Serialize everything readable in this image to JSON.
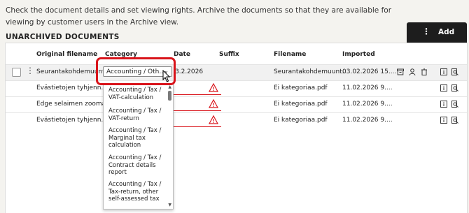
{
  "intro_text": "Check the document details and set viewing rights. Archive the documents so that they are available for viewing by customer users in the Archive view.",
  "section_title": "UNARCHIVED DOCUMENTS",
  "add_button": {
    "label": "Add",
    "icon": "kebab-icon"
  },
  "columns": {
    "original_filename": "Original filename",
    "category": "Category",
    "date": "Date",
    "suffix": "Suffix",
    "filename": "Filename",
    "imported": "Imported"
  },
  "rows": [
    {
      "original_filename": "Seurantakohdemuunt...",
      "category": "Accounting / Oth...",
      "date": "3.2.2026",
      "filename": "Seurantakohdemuunt...",
      "imported": "03.02.2026 15...."
    },
    {
      "original_filename": "Evästietojen tyhjenn...",
      "filename": "Ei kategoriaa.pdf",
      "imported": "11.02.2026 9...."
    },
    {
      "original_filename": "Edge selaimen zooma...",
      "filename": "Ei kategoriaa.pdf",
      "imported": "11.02.2026 9...."
    },
    {
      "original_filename": "Evästietojen tyhjenn...",
      "filename": "Ei kategoriaa.pdf",
      "imported": "11.02.2026 9...."
    }
  ],
  "dropdown_options": [
    "Accounting / Tax / VAT-calculation",
    "Accounting / Tax / VAT-return",
    "Accounting / Tax / Marginal tax calculation",
    "Accounting / Tax / Contract details report",
    "Accounting / Tax / Tax-return, other self-assessed tax"
  ],
  "colors": {
    "accent_red": "#d9141b",
    "button_dark": "#1d1d1d",
    "background": "#f4f3ef"
  }
}
